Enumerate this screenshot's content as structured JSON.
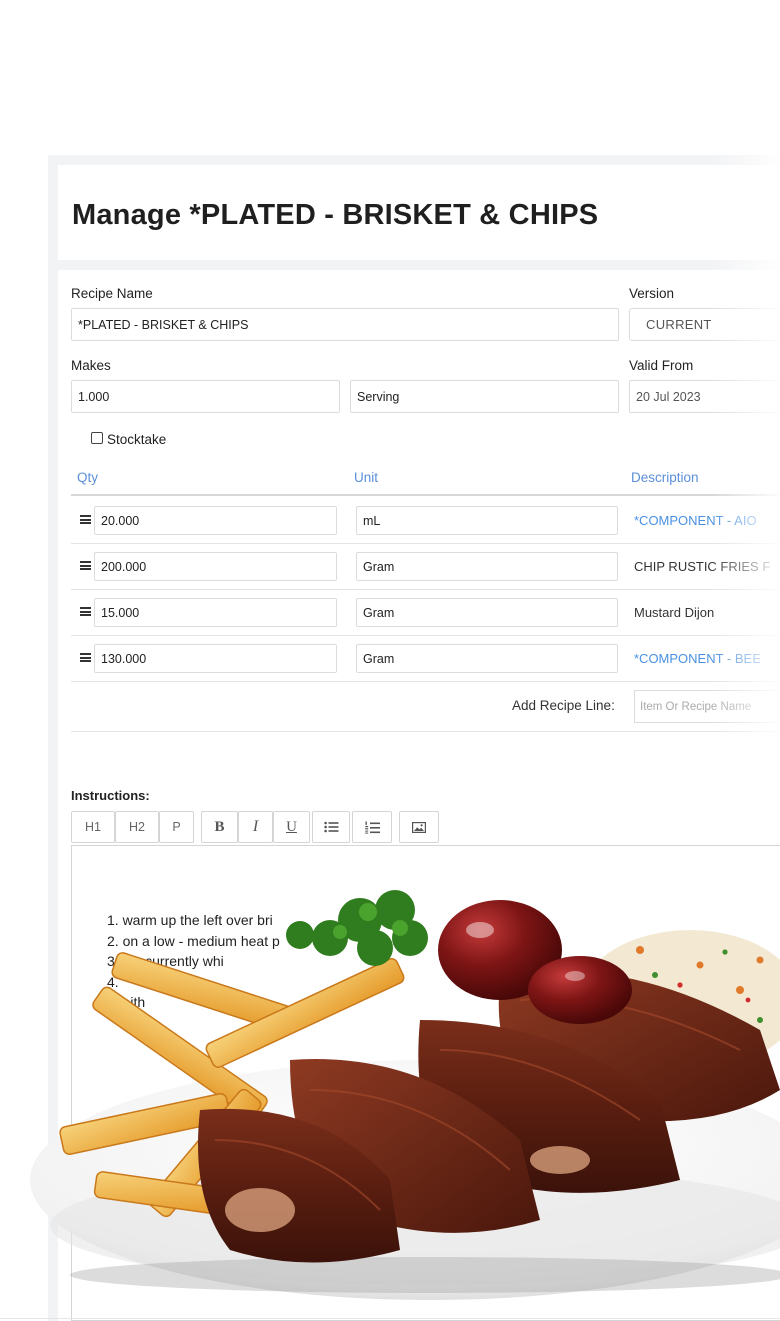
{
  "page": {
    "title": "Manage *PLATED - BRISKET & CHIPS"
  },
  "form": {
    "recipe_name_label": "Recipe Name",
    "recipe_name_value": "*PLATED - BRISKET & CHIPS",
    "version_label": "Version",
    "version_value": "CURRENT",
    "makes_label": "Makes",
    "makes_qty": "1.000",
    "makes_unit": "Serving",
    "valid_from_label": "Valid From",
    "valid_from_value": "20 Jul 2023",
    "stocktake_label": "Stocktake"
  },
  "table": {
    "headers": {
      "qty": "Qty",
      "unit": "Unit",
      "description": "Description"
    },
    "rows": [
      {
        "qty": "20.000",
        "unit": "mL",
        "description": "*COMPONENT - AIO"
      },
      {
        "qty": "200.000",
        "unit": "Gram",
        "description": "CHIP RUSTIC FRIES F"
      },
      {
        "qty": "15.000",
        "unit": "Gram",
        "description": "Mustard Dijon"
      },
      {
        "qty": "130.000",
        "unit": "Gram",
        "description": "*COMPONENT - BEE"
      }
    ],
    "add_line_label": "Add Recipe Line:",
    "add_line_placeholder": "Item Or Recipe Name"
  },
  "instructions": {
    "label": "Instructions:",
    "toolbar": {
      "h1": "H1",
      "h2": "H2",
      "p": "P",
      "bold": "B",
      "italic": "I",
      "underline": "U"
    },
    "steps": [
      "1. warm up the left over bri",
      "2. on a low - medium heat p",
      "3. concurrently whi",
      "4.",
      "5. eith"
    ]
  },
  "icons": {
    "drag": "drag-handle-icon",
    "bullet_list": "bullet-list-icon",
    "numbered_list": "numbered-list-icon",
    "image": "image-icon"
  },
  "colors": {
    "accent": "#4a90e2",
    "header_blue": "#5b8fd9",
    "panel_bg": "#f2f3f5"
  }
}
